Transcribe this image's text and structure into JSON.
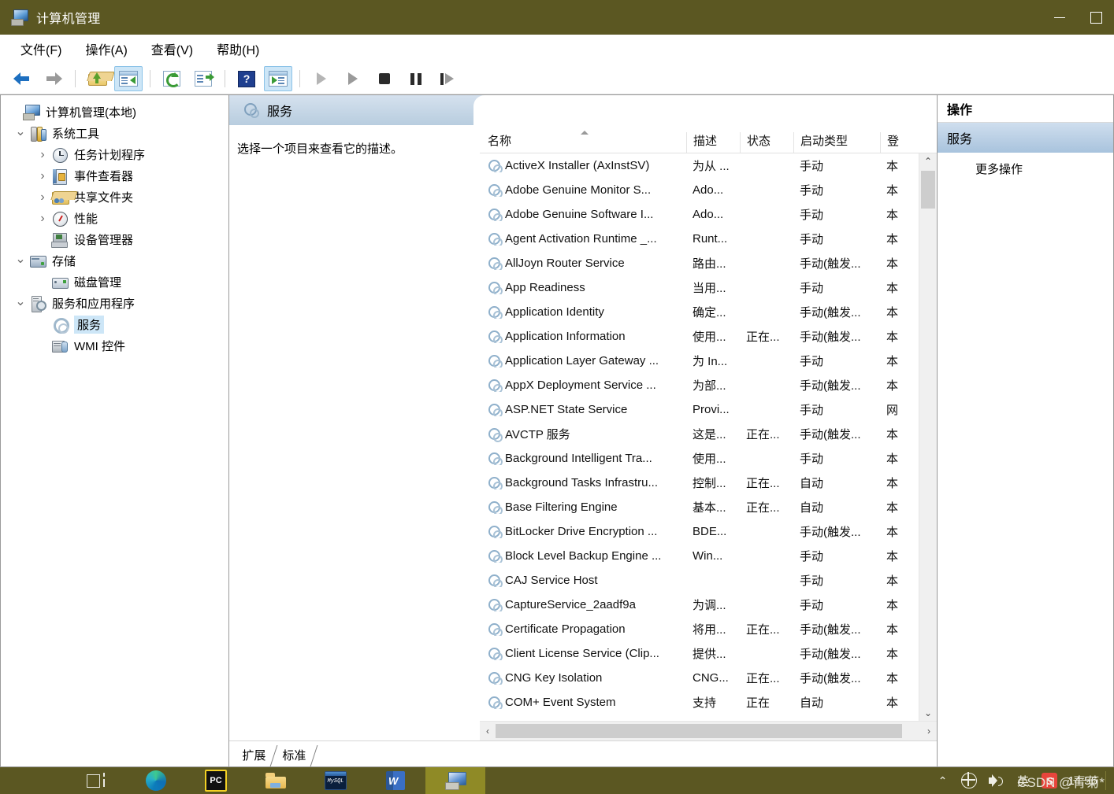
{
  "window": {
    "title": "计算机管理",
    "title_icon": "computer-management-icon",
    "buttons": {
      "minimize": "—",
      "maximize": "□"
    }
  },
  "menubar": {
    "items": [
      {
        "label": "文件(F)",
        "name": "menu-file"
      },
      {
        "label": "操作(A)",
        "name": "menu-action"
      },
      {
        "label": "查看(V)",
        "name": "menu-view"
      },
      {
        "label": "帮助(H)",
        "name": "menu-help"
      }
    ]
  },
  "toolbar": {
    "buttons": [
      {
        "icon": "back-arrow-icon",
        "active": false
      },
      {
        "icon": "forward-arrow-icon",
        "active": false
      },
      {
        "icon": "up-folder-icon",
        "active": false
      },
      {
        "icon": "show-hide-tree-icon",
        "active": true
      },
      {
        "icon": "refresh-icon",
        "active": false
      },
      {
        "icon": "export-list-icon",
        "active": false
      },
      {
        "icon": "help-icon",
        "active": false,
        "glyph": "?"
      },
      {
        "icon": "properties-icon",
        "active": true
      },
      {
        "icon": "start-service-icon",
        "active": false
      },
      {
        "icon": "resume-service-icon",
        "active": false
      },
      {
        "icon": "stop-service-icon",
        "active": false
      },
      {
        "icon": "pause-service-icon",
        "active": false
      },
      {
        "icon": "restart-service-icon",
        "active": false
      }
    ]
  },
  "tree": {
    "items": [
      {
        "label": "计算机管理(本地)",
        "indent": 0,
        "expander": "none",
        "icon": "computer-icon",
        "selected": false
      },
      {
        "label": "系统工具",
        "indent": 1,
        "expander": "down",
        "icon": "system-tools-icon",
        "selected": false
      },
      {
        "label": "任务计划程序",
        "indent": 2,
        "expander": "right",
        "icon": "task-scheduler-icon",
        "selected": false
      },
      {
        "label": "事件查看器",
        "indent": 2,
        "expander": "right",
        "icon": "event-viewer-icon",
        "selected": false
      },
      {
        "label": "共享文件夹",
        "indent": 2,
        "expander": "right",
        "icon": "shared-folders-icon",
        "selected": false
      },
      {
        "label": "性能",
        "indent": 2,
        "expander": "right",
        "icon": "performance-icon",
        "selected": false
      },
      {
        "label": "设备管理器",
        "indent": 2,
        "expander": "none",
        "icon": "device-manager-icon",
        "selected": false
      },
      {
        "label": "存储",
        "indent": 1,
        "expander": "down",
        "icon": "storage-icon",
        "selected": false
      },
      {
        "label": "磁盘管理",
        "indent": 2,
        "expander": "none",
        "icon": "disk-management-icon",
        "selected": false
      },
      {
        "label": "服务和应用程序",
        "indent": 1,
        "expander": "down",
        "icon": "services-and-applications-icon",
        "selected": false
      },
      {
        "label": "服务",
        "indent": 2,
        "expander": "none",
        "icon": "services-gear-icon",
        "selected": true
      },
      {
        "label": "WMI 控件",
        "indent": 2,
        "expander": "none",
        "icon": "wmi-control-icon",
        "selected": false
      }
    ]
  },
  "center": {
    "header_title": "服务",
    "header_icon": "services-gear-icon",
    "description_placeholder": "选择一个项目来查看它的描述。",
    "columns": [
      {
        "label": "名称",
        "name": "column-name",
        "sorted": "asc"
      },
      {
        "label": "描述",
        "name": "column-description"
      },
      {
        "label": "状态",
        "name": "column-status"
      },
      {
        "label": "启动类型",
        "name": "column-startup-type"
      },
      {
        "label": "登",
        "name": "column-logon-as"
      }
    ],
    "rows": [
      {
        "name": "ActiveX Installer (AxInstSV)",
        "desc": "为从 ...",
        "state": "",
        "start": "手动",
        "logon": "本"
      },
      {
        "name": "Adobe Genuine Monitor S...",
        "desc": "Ado...",
        "state": "",
        "start": "手动",
        "logon": "本"
      },
      {
        "name": "Adobe Genuine Software I...",
        "desc": "Ado...",
        "state": "",
        "start": "手动",
        "logon": "本"
      },
      {
        "name": "Agent Activation Runtime _...",
        "desc": "Runt...",
        "state": "",
        "start": "手动",
        "logon": "本"
      },
      {
        "name": "AllJoyn Router Service",
        "desc": "路由...",
        "state": "",
        "start": "手动(触发...",
        "logon": "本"
      },
      {
        "name": "App Readiness",
        "desc": "当用...",
        "state": "",
        "start": "手动",
        "logon": "本"
      },
      {
        "name": "Application Identity",
        "desc": "确定...",
        "state": "",
        "start": "手动(触发...",
        "logon": "本"
      },
      {
        "name": "Application Information",
        "desc": "使用...",
        "state": "正在...",
        "start": "手动(触发...",
        "logon": "本"
      },
      {
        "name": "Application Layer Gateway ...",
        "desc": "为 In...",
        "state": "",
        "start": "手动",
        "logon": "本"
      },
      {
        "name": "AppX Deployment Service ...",
        "desc": "为部...",
        "state": "",
        "start": "手动(触发...",
        "logon": "本"
      },
      {
        "name": "ASP.NET State Service",
        "desc": "Provi...",
        "state": "",
        "start": "手动",
        "logon": "网"
      },
      {
        "name": "AVCTP 服务",
        "desc": "这是...",
        "state": "正在...",
        "start": "手动(触发...",
        "logon": "本"
      },
      {
        "name": "Background Intelligent Tra...",
        "desc": "使用...",
        "state": "",
        "start": "手动",
        "logon": "本"
      },
      {
        "name": "Background Tasks Infrastru...",
        "desc": "控制...",
        "state": "正在...",
        "start": "自动",
        "logon": "本"
      },
      {
        "name": "Base Filtering Engine",
        "desc": "基本...",
        "state": "正在...",
        "start": "自动",
        "logon": "本"
      },
      {
        "name": "BitLocker Drive Encryption ...",
        "desc": "BDE...",
        "state": "",
        "start": "手动(触发...",
        "logon": "本"
      },
      {
        "name": "Block Level Backup Engine ...",
        "desc": "Win...",
        "state": "",
        "start": "手动",
        "logon": "本"
      },
      {
        "name": "CAJ Service Host",
        "desc": "",
        "state": "",
        "start": "手动",
        "logon": "本"
      },
      {
        "name": "CaptureService_2aadf9a",
        "desc": "为调...",
        "state": "",
        "start": "手动",
        "logon": "本"
      },
      {
        "name": "Certificate Propagation",
        "desc": "将用...",
        "state": "正在...",
        "start": "手动(触发...",
        "logon": "本"
      },
      {
        "name": "Client License Service (Clip...",
        "desc": "提供...",
        "state": "",
        "start": "手动(触发...",
        "logon": "本"
      },
      {
        "name": "CNG Key Isolation",
        "desc": "CNG...",
        "state": "正在...",
        "start": "手动(触发...",
        "logon": "本"
      },
      {
        "name": "COM+ Event System",
        "desc": "支持",
        "state": "正在",
        "start": "自动",
        "logon": "本"
      }
    ],
    "tabs": [
      {
        "label": "扩展",
        "name": "tab-extended",
        "selected": false
      },
      {
        "label": "标准",
        "name": "tab-standard",
        "selected": true
      }
    ],
    "scroll": {
      "up_glyph": "⌃",
      "down_glyph": "⌄",
      "left_glyph": "‹",
      "right_glyph": "›"
    }
  },
  "actions": {
    "title": "操作",
    "section": "服务",
    "items": [
      {
        "label": "更多操作",
        "name": "action-more-actions"
      }
    ]
  },
  "taskbar": {
    "items": [
      {
        "name": "taskview-button",
        "icon": "task-view-icon",
        "active": false
      },
      {
        "name": "edge-button",
        "icon": "edge-icon",
        "active": false
      },
      {
        "name": "pc-app-button",
        "icon": "pc-icon",
        "label": "PC",
        "active": false
      },
      {
        "name": "file-explorer-button",
        "icon": "folder-icon",
        "active": false
      },
      {
        "name": "mysql-button",
        "icon": "mysql-icon",
        "label": "MySQL",
        "active": false
      },
      {
        "name": "word-button",
        "icon": "word-icon",
        "label": "W",
        "active": false
      },
      {
        "name": "computer-management-button",
        "icon": "computer-management-icon",
        "active": true
      }
    ],
    "tray": [
      {
        "name": "show-hidden-icons",
        "icon": "chevron-up-icon",
        "glyph": "⌃"
      },
      {
        "name": "network-icon",
        "icon": "globe-icon"
      },
      {
        "name": "volume-icon",
        "icon": "speaker-icon"
      },
      {
        "name": "ime-indicator",
        "icon": "ime-icon",
        "glyph": "英"
      },
      {
        "name": "sogou-input-icon",
        "icon": "sogou-icon",
        "glyph": "S"
      }
    ],
    "clock": "14:56"
  },
  "watermark": "CSDN @青菊*",
  "colors": {
    "titlebar": "#5b5722",
    "accent_select": "#cde6f7",
    "header_gradient_top": "#d5e1ee",
    "header_gradient_bottom": "#b8cddf",
    "taskbar": "#5b5722",
    "taskbar_active": "#8f8a26"
  }
}
